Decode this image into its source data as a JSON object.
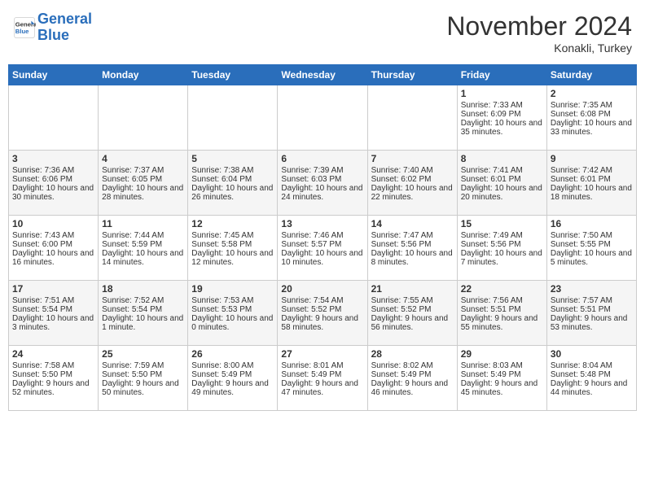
{
  "header": {
    "logo_line1": "General",
    "logo_line2": "Blue",
    "month": "November 2024",
    "location": "Konakli, Turkey"
  },
  "days_of_week": [
    "Sunday",
    "Monday",
    "Tuesday",
    "Wednesday",
    "Thursday",
    "Friday",
    "Saturday"
  ],
  "weeks": [
    [
      {
        "day": "",
        "info": ""
      },
      {
        "day": "",
        "info": ""
      },
      {
        "day": "",
        "info": ""
      },
      {
        "day": "",
        "info": ""
      },
      {
        "day": "",
        "info": ""
      },
      {
        "day": "1",
        "info": "Sunrise: 7:33 AM\nSunset: 6:09 PM\nDaylight: 10 hours and 35 minutes."
      },
      {
        "day": "2",
        "info": "Sunrise: 7:35 AM\nSunset: 6:08 PM\nDaylight: 10 hours and 33 minutes."
      }
    ],
    [
      {
        "day": "3",
        "info": "Sunrise: 7:36 AM\nSunset: 6:06 PM\nDaylight: 10 hours and 30 minutes."
      },
      {
        "day": "4",
        "info": "Sunrise: 7:37 AM\nSunset: 6:05 PM\nDaylight: 10 hours and 28 minutes."
      },
      {
        "day": "5",
        "info": "Sunrise: 7:38 AM\nSunset: 6:04 PM\nDaylight: 10 hours and 26 minutes."
      },
      {
        "day": "6",
        "info": "Sunrise: 7:39 AM\nSunset: 6:03 PM\nDaylight: 10 hours and 24 minutes."
      },
      {
        "day": "7",
        "info": "Sunrise: 7:40 AM\nSunset: 6:02 PM\nDaylight: 10 hours and 22 minutes."
      },
      {
        "day": "8",
        "info": "Sunrise: 7:41 AM\nSunset: 6:01 PM\nDaylight: 10 hours and 20 minutes."
      },
      {
        "day": "9",
        "info": "Sunrise: 7:42 AM\nSunset: 6:01 PM\nDaylight: 10 hours and 18 minutes."
      }
    ],
    [
      {
        "day": "10",
        "info": "Sunrise: 7:43 AM\nSunset: 6:00 PM\nDaylight: 10 hours and 16 minutes."
      },
      {
        "day": "11",
        "info": "Sunrise: 7:44 AM\nSunset: 5:59 PM\nDaylight: 10 hours and 14 minutes."
      },
      {
        "day": "12",
        "info": "Sunrise: 7:45 AM\nSunset: 5:58 PM\nDaylight: 10 hours and 12 minutes."
      },
      {
        "day": "13",
        "info": "Sunrise: 7:46 AM\nSunset: 5:57 PM\nDaylight: 10 hours and 10 minutes."
      },
      {
        "day": "14",
        "info": "Sunrise: 7:47 AM\nSunset: 5:56 PM\nDaylight: 10 hours and 8 minutes."
      },
      {
        "day": "15",
        "info": "Sunrise: 7:49 AM\nSunset: 5:56 PM\nDaylight: 10 hours and 7 minutes."
      },
      {
        "day": "16",
        "info": "Sunrise: 7:50 AM\nSunset: 5:55 PM\nDaylight: 10 hours and 5 minutes."
      }
    ],
    [
      {
        "day": "17",
        "info": "Sunrise: 7:51 AM\nSunset: 5:54 PM\nDaylight: 10 hours and 3 minutes."
      },
      {
        "day": "18",
        "info": "Sunrise: 7:52 AM\nSunset: 5:54 PM\nDaylight: 10 hours and 1 minute."
      },
      {
        "day": "19",
        "info": "Sunrise: 7:53 AM\nSunset: 5:53 PM\nDaylight: 10 hours and 0 minutes."
      },
      {
        "day": "20",
        "info": "Sunrise: 7:54 AM\nSunset: 5:52 PM\nDaylight: 9 hours and 58 minutes."
      },
      {
        "day": "21",
        "info": "Sunrise: 7:55 AM\nSunset: 5:52 PM\nDaylight: 9 hours and 56 minutes."
      },
      {
        "day": "22",
        "info": "Sunrise: 7:56 AM\nSunset: 5:51 PM\nDaylight: 9 hours and 55 minutes."
      },
      {
        "day": "23",
        "info": "Sunrise: 7:57 AM\nSunset: 5:51 PM\nDaylight: 9 hours and 53 minutes."
      }
    ],
    [
      {
        "day": "24",
        "info": "Sunrise: 7:58 AM\nSunset: 5:50 PM\nDaylight: 9 hours and 52 minutes."
      },
      {
        "day": "25",
        "info": "Sunrise: 7:59 AM\nSunset: 5:50 PM\nDaylight: 9 hours and 50 minutes."
      },
      {
        "day": "26",
        "info": "Sunrise: 8:00 AM\nSunset: 5:49 PM\nDaylight: 9 hours and 49 minutes."
      },
      {
        "day": "27",
        "info": "Sunrise: 8:01 AM\nSunset: 5:49 PM\nDaylight: 9 hours and 47 minutes."
      },
      {
        "day": "28",
        "info": "Sunrise: 8:02 AM\nSunset: 5:49 PM\nDaylight: 9 hours and 46 minutes."
      },
      {
        "day": "29",
        "info": "Sunrise: 8:03 AM\nSunset: 5:49 PM\nDaylight: 9 hours and 45 minutes."
      },
      {
        "day": "30",
        "info": "Sunrise: 8:04 AM\nSunset: 5:48 PM\nDaylight: 9 hours and 44 minutes."
      }
    ]
  ]
}
